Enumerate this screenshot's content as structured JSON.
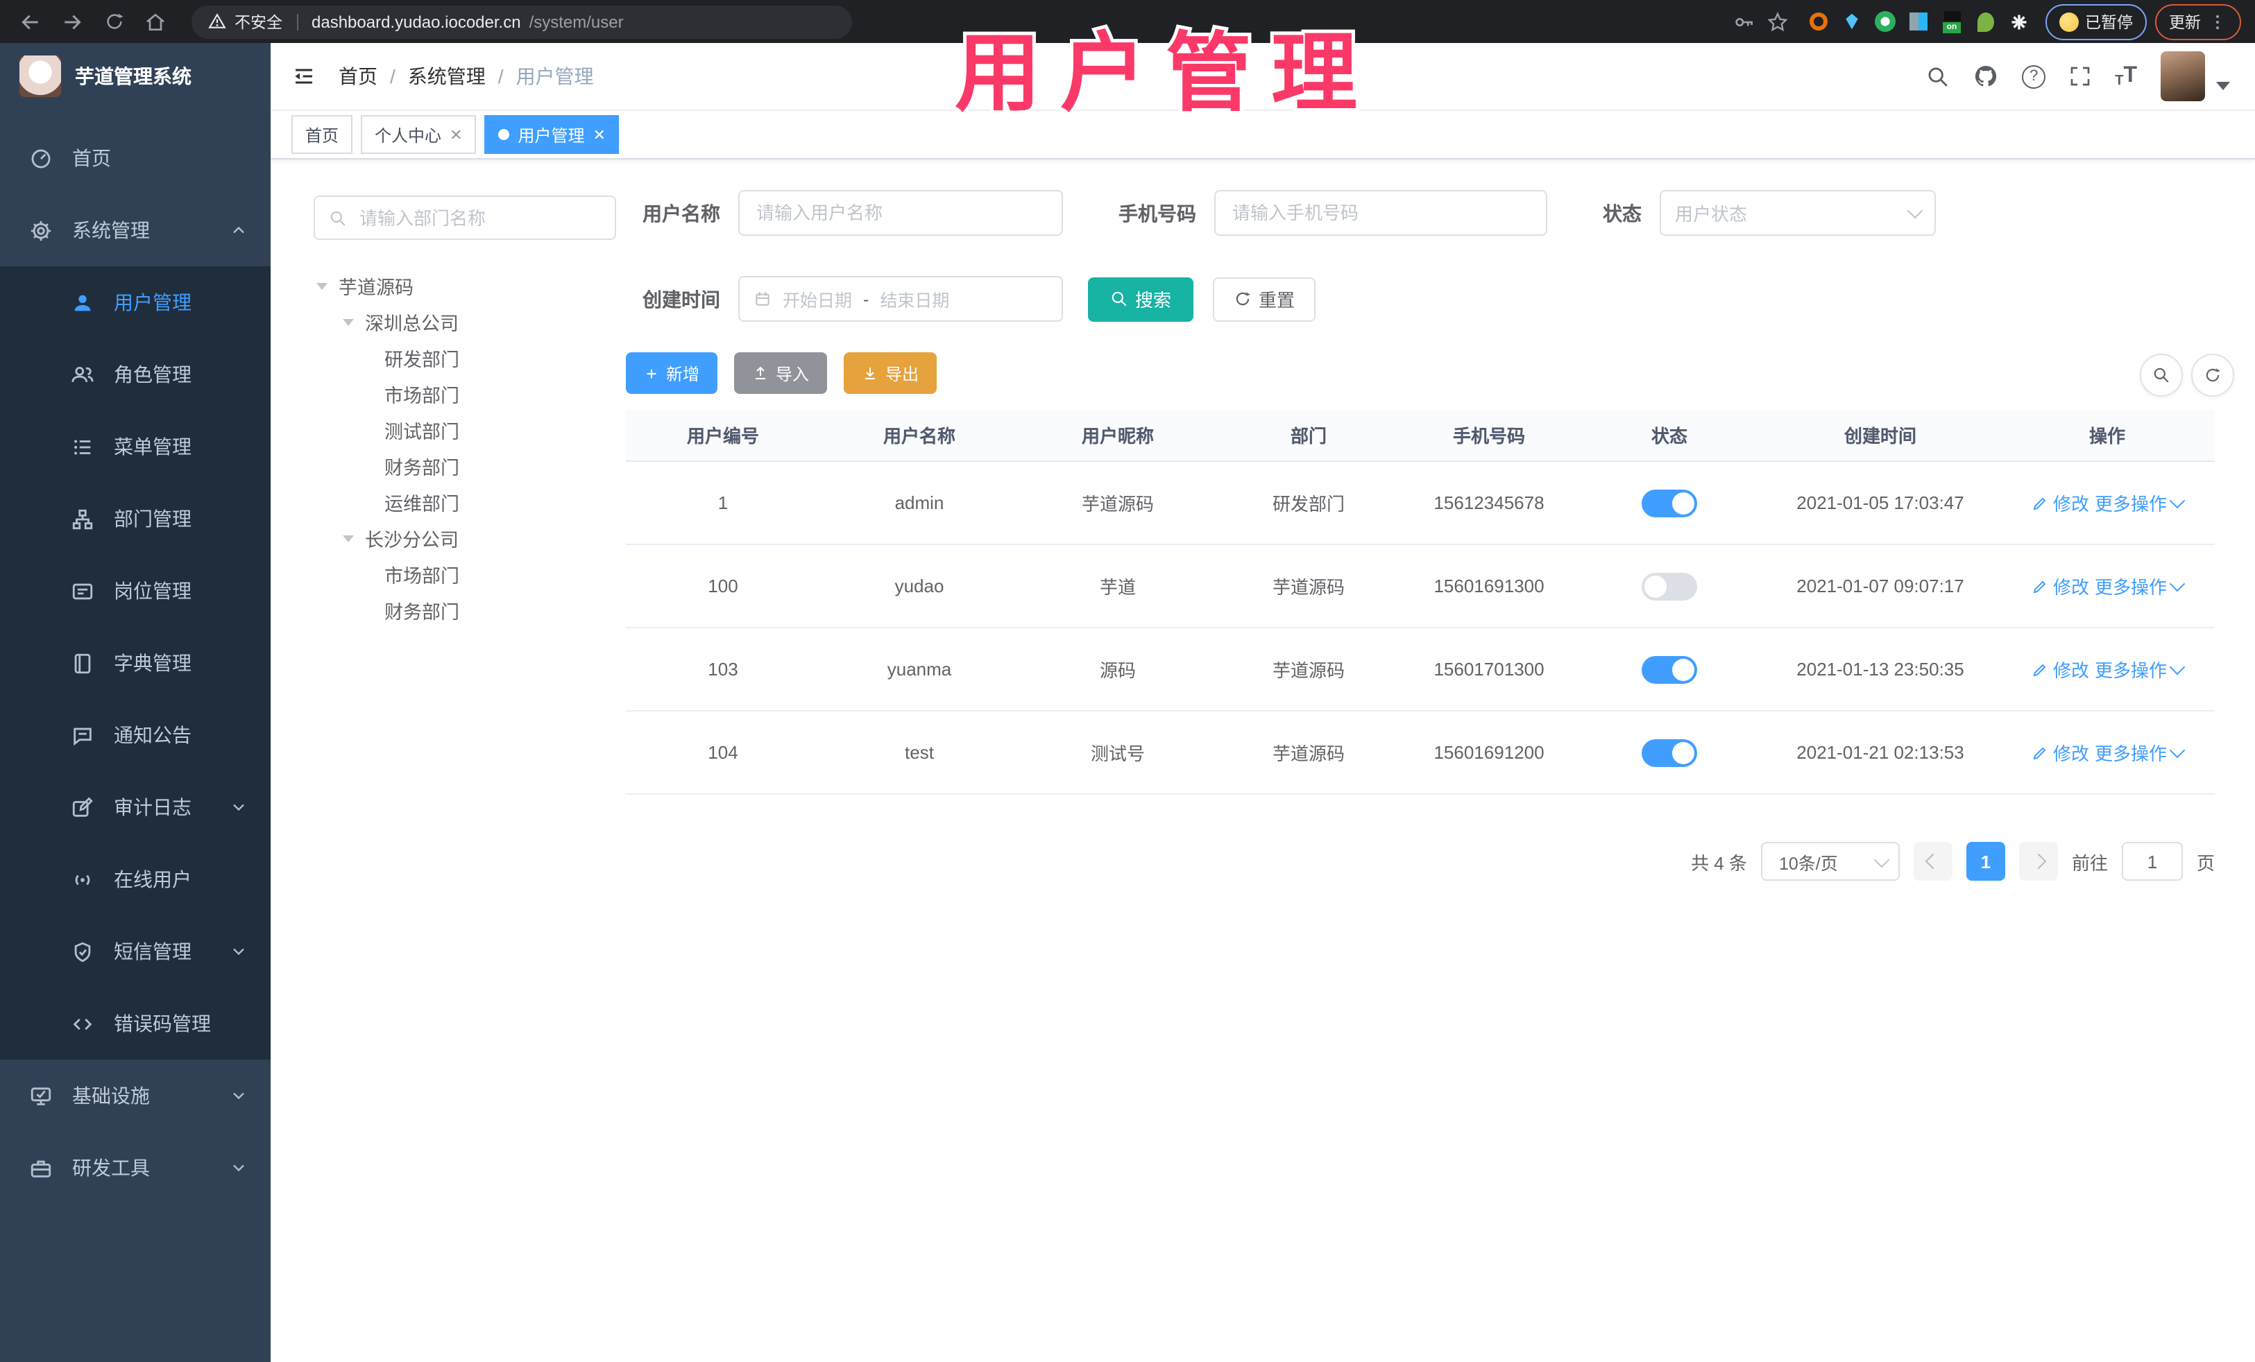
{
  "browser": {
    "security_label": "不安全",
    "url_host": "dashboard.yudao.iocoder.cn",
    "url_path": "/system/user",
    "paused_label": "已暂停",
    "update_label": "更新"
  },
  "watermark": {
    "text": "用户管理",
    "color": "#fb3968"
  },
  "header": {
    "logo_title": "芋道管理系统",
    "breadcrumb": [
      "首页",
      "系统管理",
      "用户管理"
    ]
  },
  "tabs": [
    {
      "label": "首页"
    },
    {
      "label": "个人中心"
    },
    {
      "label": "用户管理"
    }
  ],
  "sidebar": {
    "items": [
      {
        "label": "首页"
      },
      {
        "label": "系统管理"
      },
      {
        "label": "用户管理"
      },
      {
        "label": "角色管理"
      },
      {
        "label": "菜单管理"
      },
      {
        "label": "部门管理"
      },
      {
        "label": "岗位管理"
      },
      {
        "label": "字典管理"
      },
      {
        "label": "通知公告"
      },
      {
        "label": "审计日志"
      },
      {
        "label": "在线用户"
      },
      {
        "label": "短信管理"
      },
      {
        "label": "错误码管理"
      },
      {
        "label": "基础设施"
      },
      {
        "label": "研发工具"
      }
    ]
  },
  "tree": {
    "search_placeholder": "请输入部门名称",
    "nodes": [
      "芋道源码",
      "深圳总公司",
      "研发部门",
      "市场部门",
      "测试部门",
      "财务部门",
      "运维部门",
      "长沙分公司",
      "市场部门",
      "财务部门"
    ]
  },
  "filters": {
    "username_label": "用户名称",
    "username_placeholder": "请输入用户名称",
    "mobile_label": "手机号码",
    "mobile_placeholder": "请输入手机号码",
    "status_label": "状态",
    "status_placeholder": "用户状态",
    "create_time_label": "创建时间",
    "date_start_placeholder": "开始日期",
    "date_separator": "-",
    "date_end_placeholder": "结束日期",
    "search_label": "搜索",
    "reset_label": "重置"
  },
  "toolbar": {
    "add_label": "新增",
    "import_label": "导入",
    "export_label": "导出"
  },
  "table": {
    "columns": [
      "用户编号",
      "用户名称",
      "用户昵称",
      "部门",
      "手机号码",
      "状态",
      "创建时间",
      "操作"
    ],
    "actions": {
      "edit": "修改",
      "more": "更多操作"
    },
    "rows": [
      {
        "id": "1",
        "username": "admin",
        "nickname": "芋道源码",
        "dept": "研发部门",
        "mobile": "15612345678",
        "status": "on",
        "create_time": "2021-01-05 17:03:47"
      },
      {
        "id": "100",
        "username": "yudao",
        "nickname": "芋道",
        "dept": "芋道源码",
        "mobile": "15601691300",
        "status": "off",
        "create_time": "2021-01-07 09:07:17"
      },
      {
        "id": "103",
        "username": "yuanma",
        "nickname": "源码",
        "dept": "芋道源码",
        "mobile": "15601701300",
        "status": "on",
        "create_time": "2021-01-13 23:50:35"
      },
      {
        "id": "104",
        "username": "test",
        "nickname": "测试号",
        "dept": "芋道源码",
        "mobile": "15601691200",
        "status": "on",
        "create_time": "2021-01-21 02:13:53"
      }
    ]
  },
  "pagination": {
    "total_label": "共 4 条",
    "page_size": "10条/页",
    "page": "1",
    "goto_label": "前往",
    "goto_value": "1",
    "page_suffix": "页"
  },
  "colors": {
    "accent": "#409eff",
    "search_button": "#17b3a3",
    "export_button": "#e6a23c",
    "import_button": "#909399",
    "watermark_pink": "#fb3968",
    "sidebar_bg": "#304156",
    "submenu_bg": "#1f2d3d"
  }
}
